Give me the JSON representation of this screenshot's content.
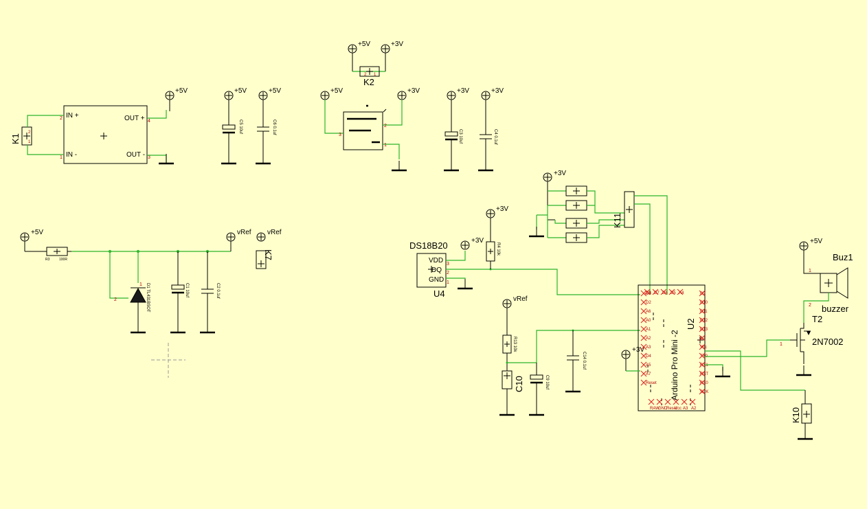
{
  "colors": {
    "background": "#ffffcc",
    "wire": "#2bb52b",
    "symbol": "#000000",
    "pin": "#b00000",
    "unconnected": "#e02020"
  },
  "nets": {
    "p5v": "+5V",
    "p3v": "+3V",
    "vref": "vRef"
  },
  "parts": {
    "k1": {
      "ref": "K1",
      "pin1": "1",
      "pin2": "2"
    },
    "k2": {
      "ref": "K2",
      "pin1": "1",
      "pin2": "2"
    },
    "reg1": {
      "in_plus": "IN +",
      "in_minus": "IN -",
      "out_plus": "OUT +",
      "out_minus": "OUT -",
      "p1": "1",
      "p2": "2",
      "p3": "3",
      "p4": "4"
    },
    "reg2": {
      "p1": "1",
      "p2": "2",
      "p3": "3"
    },
    "c5": "C5 10uf",
    "c6": "C6 0.1uf",
    "c3": "C3 10uf",
    "c4": "C4 0.1uf",
    "r3": {
      "ref": "R3",
      "val": "100R"
    },
    "d1": "D1 TL431BSOT",
    "c1": "C1 10uf",
    "c2": "C2 0.1uf",
    "k7": "K7",
    "u4": {
      "title": "DS18B20",
      "ref": "U4",
      "vdd": "VDD",
      "dq": "DQ",
      "gnd": "GND",
      "p1": "1",
      "p2": "2",
      "p3": "3"
    },
    "r4": "R4 10k",
    "r13": "R13 10k",
    "c10": "C10",
    "c9": "C9 10uf",
    "c14": "C14 0.1uf",
    "k11": "K11",
    "u2": {
      "name": "Arduino Pro Mini -2",
      "ref": "U2"
    },
    "buz1": {
      "ref": "Buz1",
      "val": "buzzer"
    },
    "t2": {
      "ref": "T2",
      "val": "2N7002"
    },
    "k10": "K10"
  },
  "u2_pins": {
    "top": [
      "D8",
      "D7",
      "D6",
      "D5",
      "A4"
    ],
    "left": [
      "D3",
      "D2",
      "A6",
      "A0",
      "A1",
      "A2",
      "A3",
      "D4",
      "A5",
      "A7",
      "Reset"
    ],
    "right": [
      "D9",
      "D10",
      "D11",
      "D12",
      "D13",
      "A2",
      "Vcc",
      "TX0",
      "RX1",
      "RST",
      "RX0",
      "SCK"
    ],
    "bottom": [
      "RAW",
      "GND",
      "Reset",
      "Vcc",
      "A3",
      "A2"
    ]
  }
}
